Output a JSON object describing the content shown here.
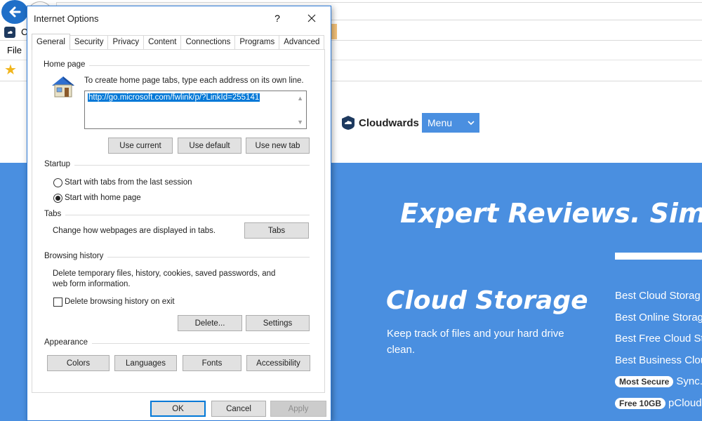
{
  "browser": {
    "tab_title": "C",
    "menu_file": "File"
  },
  "site": {
    "logo_text": "Cloudwards",
    "menu_button": "Menu",
    "hero_title": "Expert Reviews. Simple S",
    "section_title": "Cloud Storage",
    "section_desc": "Keep track of files and your hard drive clean.",
    "links": [
      {
        "badge": "",
        "text": "Best Cloud Storag"
      },
      {
        "badge": "",
        "text": "Best Online Storag"
      },
      {
        "badge": "",
        "text": "Best Free Cloud St"
      },
      {
        "badge": "",
        "text": "Best Business Clou"
      },
      {
        "badge": "Most Secure",
        "text": "Sync."
      },
      {
        "badge": "Free 10GB",
        "text": "pCloud"
      }
    ],
    "colors": {
      "hero_bg": "#4a8fe0",
      "accent": "#1f6fc8"
    }
  },
  "dialog": {
    "title": "Internet Options",
    "help": "?",
    "tabs": [
      "General",
      "Security",
      "Privacy",
      "Content",
      "Connections",
      "Programs",
      "Advanced"
    ],
    "active_tab": "General",
    "home_page": {
      "label": "Home page",
      "instruction": "To create home page tabs, type each address on its own line.",
      "url": "http://go.microsoft.com/fwlink/p/?LinkId=255141",
      "use_current": "Use current",
      "use_default": "Use default",
      "use_new_tab": "Use new tab"
    },
    "startup": {
      "label": "Startup",
      "option_last_session": "Start with tabs from the last session",
      "option_home_page": "Start with home page",
      "selected": "Start with home page"
    },
    "tabs_group": {
      "label": "Tabs",
      "description": "Change how webpages are displayed in tabs.",
      "button": "Tabs"
    },
    "browsing_history": {
      "label": "Browsing history",
      "description_line1": "Delete temporary files, history, cookies, saved passwords, and",
      "description_line2": "web form information.",
      "delete_on_exit": "Delete browsing history on exit",
      "delete_on_exit_checked": false,
      "delete_button": "Delete...",
      "settings_button": "Settings"
    },
    "appearance": {
      "label": "Appearance",
      "colors": "Colors",
      "languages": "Languages",
      "fonts": "Fonts",
      "accessibility": "Accessibility"
    },
    "footer": {
      "ok": "OK",
      "cancel": "Cancel",
      "apply": "Apply"
    }
  }
}
